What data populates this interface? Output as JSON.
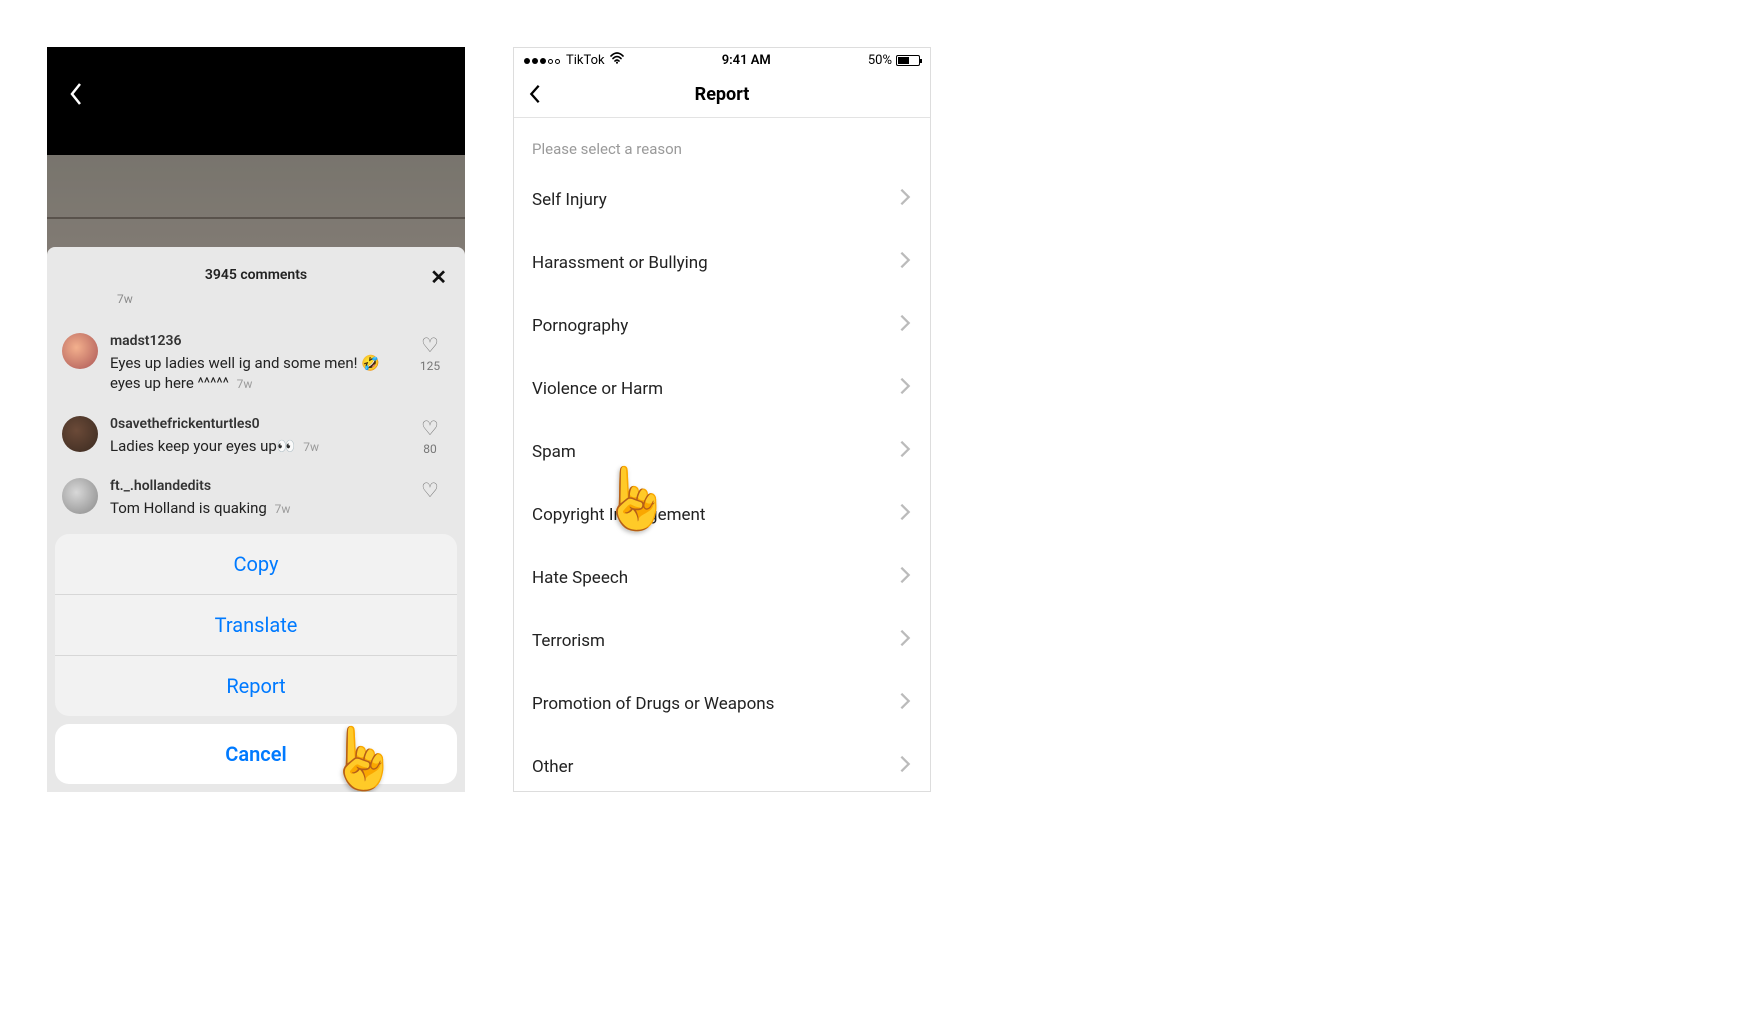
{
  "phone1": {
    "comments_header": "3945 comments",
    "prev_time": "7w",
    "comments": [
      {
        "user": "madst1236",
        "text": "Eyes up ladies well ig and some men! 🤣 eyes up here ^^^^^",
        "time": "7w",
        "likes": "125"
      },
      {
        "user": "0savethefrickenturtles0",
        "text": "Ladies keep your eyes up👀",
        "time": "7w",
        "likes": "80"
      },
      {
        "user": "ft._.hollandedits",
        "text": "Tom Holland is quaking",
        "time": "7w",
        "likes": ""
      }
    ],
    "sheet": {
      "copy": "Copy",
      "translate": "Translate",
      "report": "Report",
      "cancel": "Cancel"
    }
  },
  "phone2": {
    "status": {
      "carrier": "TikTok",
      "time": "9:41 AM",
      "battery": "50%"
    },
    "title": "Report",
    "prompt": "Please select a reason",
    "reasons": [
      "Self Injury",
      "Harassment or Bullying",
      "Pornography",
      "Violence or Harm",
      "Spam",
      "Copyright Infringement",
      "Hate Speech",
      "Terrorism",
      "Promotion of Drugs or Weapons",
      "Other"
    ]
  }
}
